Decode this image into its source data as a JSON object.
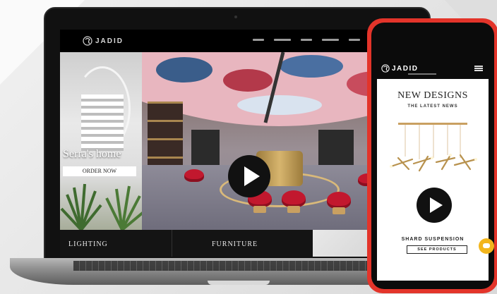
{
  "laptop_site": {
    "logo_text": "JADID",
    "hero_title": "Serra's home",
    "order_button": "ORDER NOW",
    "categories": [
      "LIGHTING",
      "FURNITURE"
    ]
  },
  "phone_site": {
    "logo_text": "JADID",
    "title": "NEW DESIGNS",
    "subtitle": "THE LATEST NEWS",
    "product_name": "SHARD SUSPENSION",
    "button": "SEE PRODUCTS"
  },
  "colors": {
    "phone_frame": "#e3342a",
    "stool_red": "#c2182e",
    "gold": "#c9a061",
    "chat_yellow": "#f2b51c"
  },
  "icons": [
    "logo-mark-icon",
    "play-icon",
    "hamburger-menu-icon",
    "chat-icon"
  ]
}
